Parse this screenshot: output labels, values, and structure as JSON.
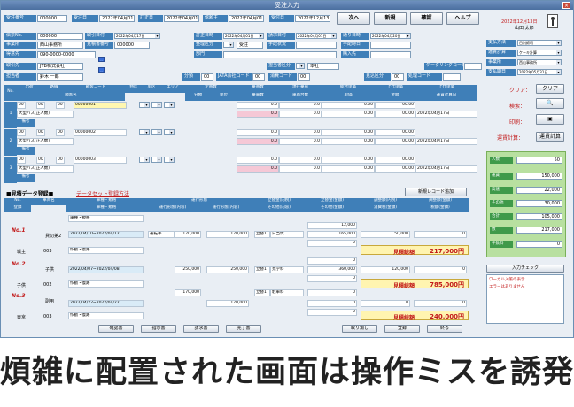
{
  "window": {
    "title": "受注入力",
    "close": "×"
  },
  "top": {
    "order_no_label": "受注番号",
    "order_no": "000000",
    "order_date_label": "受注日",
    "order_date": "2022年04月01日",
    "input_date_label": "訂正日",
    "input_date": "2022年04月01日",
    "inquiry_label": "依頼主",
    "inquiry_date": "2022年04月01日",
    "delivery_label": "受付日",
    "delivery_date": "2022年12月13日",
    "next": "次へ",
    "new": "新規",
    "confirm": "確認",
    "help": "ヘルプ",
    "today": "2022年12月13日",
    "user": "山田 太郎"
  },
  "rows": [
    {
      "label": "伝票No.",
      "value": "000000"
    },
    {
      "label": "事業所",
      "value": "西山事務所"
    },
    {
      "label": "得意先",
      "value": "090-0000-0000"
    },
    {
      "label": "取引先",
      "value": "JTB株式会社"
    },
    {
      "label": "担当者",
      "value": "鈴木 一郎"
    }
  ],
  "mid_labels": {
    "l1": "取引日付",
    "v1": "2022年04月17日",
    "l2": "見積書番号",
    "v2": "000000",
    "l3": "訂正日時",
    "v3": "2022年04月01日",
    "l4": "請求日付",
    "v4": "2022年04月01日",
    "l5": "通り日時",
    "v5": "2022年04月20日",
    "l6": "整理区分",
    "v6": "受注",
    "l7": "手配状況",
    "l8": "手配時日",
    "l9": "部門",
    "l10": "購入先",
    "l11": "担当者区分",
    "v11": "本社",
    "l12": "ケータリングコード",
    "l13": "分類",
    "v13": "00",
    "l14": "JATA会社コード",
    "v14": "00",
    "l15": "消費コード",
    "v15": "00",
    "l16": "見込区分",
    "v16": "00",
    "l17": "処理コード"
  },
  "right_panel": {
    "items": [
      {
        "label": "支払方法",
        "value": "日別締切"
      },
      {
        "label": "運賃計算",
        "value": "ケーキ計算"
      },
      {
        "label": "事業所",
        "value": "西山事務所"
      },
      {
        "label": "支払期日",
        "value": "2022年05月31日"
      }
    ],
    "clear_label": "クリア：",
    "clear_btn": "クリア",
    "search_label": "検索：",
    "print_label": "印刷：",
    "calc_label": "運賃計算：",
    "calc_btn": "運賃計算"
  },
  "grid_headers": [
    "No.",
    "出荷",
    "路線",
    "顧客コード",
    "特区",
    "単区",
    "エリア",
    "定員数",
    "乗員数",
    "現在乗車",
    "総合単価",
    "上代単価",
    "上代単価"
  ],
  "grid_sub": [
    "顧客名",
    "分類",
    "単位",
    "乗車数",
    "車両台数",
    "単価",
    "金額",
    "運賃計算日"
  ],
  "grid_rows": [
    {
      "no": "1",
      "code": "00000001",
      "name": "大型バス(正人数)",
      "note": "備考",
      "v1": "0.0",
      "v2": "0.0",
      "v3": "0.00",
      "v4": "00.00",
      "v5": "2022年04月17日",
      "row2": "00.00"
    },
    {
      "no": "2",
      "code": "00000002",
      "name": "大型バス(正人数)",
      "note": "備考",
      "v1": "0.0",
      "v2": "0.0",
      "v3": "0.00",
      "v4": "00.00",
      "v5": "2022年04月17日",
      "row2": "00.00"
    },
    {
      "no": "3",
      "code": "00000003",
      "name": "大型バス(正人数)",
      "note": "備考",
      "v1": "0.0",
      "v2": "0.0",
      "v3": "0.00",
      "v4": "00.00",
      "v5": "2022年04月17日",
      "row2": "00.00"
    }
  ],
  "summary": [
    {
      "label": "人数",
      "value": "50"
    },
    {
      "label": "運賃",
      "value": "150,000"
    },
    {
      "label": "高速",
      "value": "22,000"
    },
    {
      "label": "その他",
      "value": "30,000"
    },
    {
      "label": "合計",
      "value": "105,000"
    },
    {
      "label": "数",
      "value": "217,000"
    },
    {
      "label": "手数料",
      "value": "0"
    }
  ],
  "estimate": {
    "section_title": "■見積データ登録■",
    "method_link": "データセット登録方法",
    "new_btn": "新規レコード追加",
    "headers": [
      "No.",
      "車両名",
      "車種・規格",
      "運行形態",
      "立替金(内税)",
      "立替金(金額)",
      "調整額(内税)",
      "調整額(金額)"
    ],
    "subheaders": [
      "登録",
      "車種・規格",
      "運行形態(内容)",
      "運行形態(内容)",
      "その他(内容)",
      "その他(金額)",
      "消費税(金額)",
      "税額(金額)"
    ],
    "items": [
      {
        "no": "No.1",
        "name": "貸切第2",
        "d1": "2022/04/10~2022/04/12",
        "d2": "作動・復路",
        "v1": "170,000",
        "v2": "170,000",
        "tag": "立替1",
        "tag_v": "日当代",
        "amt": "12,000",
        "amt2": "165,000",
        "amt3": "0",
        "r1": "50,000",
        "r2": "0",
        "total_label": "見積総額",
        "total": "217,000円",
        "sub1": "城主",
        "sub2": "003"
      },
      {
        "no": "No.2",
        "name": "子供",
        "d1": "2022/04/07~2022/04/08",
        "d2": "作動・復路",
        "v1": "250,000",
        "v2": "250,000",
        "tag": "立替1",
        "tag_v": "見学料",
        "amt": "0",
        "amt2": "360,000",
        "amt3": "0",
        "r1": "120,000",
        "r2": "0",
        "total_label": "見積総額",
        "total": "785,000円",
        "sub1": "子供",
        "sub2": "002"
      },
      {
        "no": "No.3",
        "name": "副用",
        "d1": "2022/04/22~2022/04/22",
        "d2": "作動・復路",
        "v1": "170,000",
        "v2": "170,000",
        "tag": "立替1",
        "tag_v": "駐車料",
        "amt": "0",
        "amt2": "0",
        "amt3": "0",
        "r1": "0",
        "r2": "0",
        "total_label": "見積総額",
        "total": "240,000円",
        "sub1": "東京",
        "sub2": "003"
      }
    ]
  },
  "input_check": {
    "title": "入力チェック",
    "msg1": "ワーカル入帳の表示",
    "msg2": "エラーはありません"
  },
  "footer_buttons": [
    "確認書",
    "指示書",
    "請求書",
    "完了書",
    "取り消し",
    "登録",
    "終る"
  ],
  "caption": "煩雑に配置された画面は操作ミスを誘発"
}
